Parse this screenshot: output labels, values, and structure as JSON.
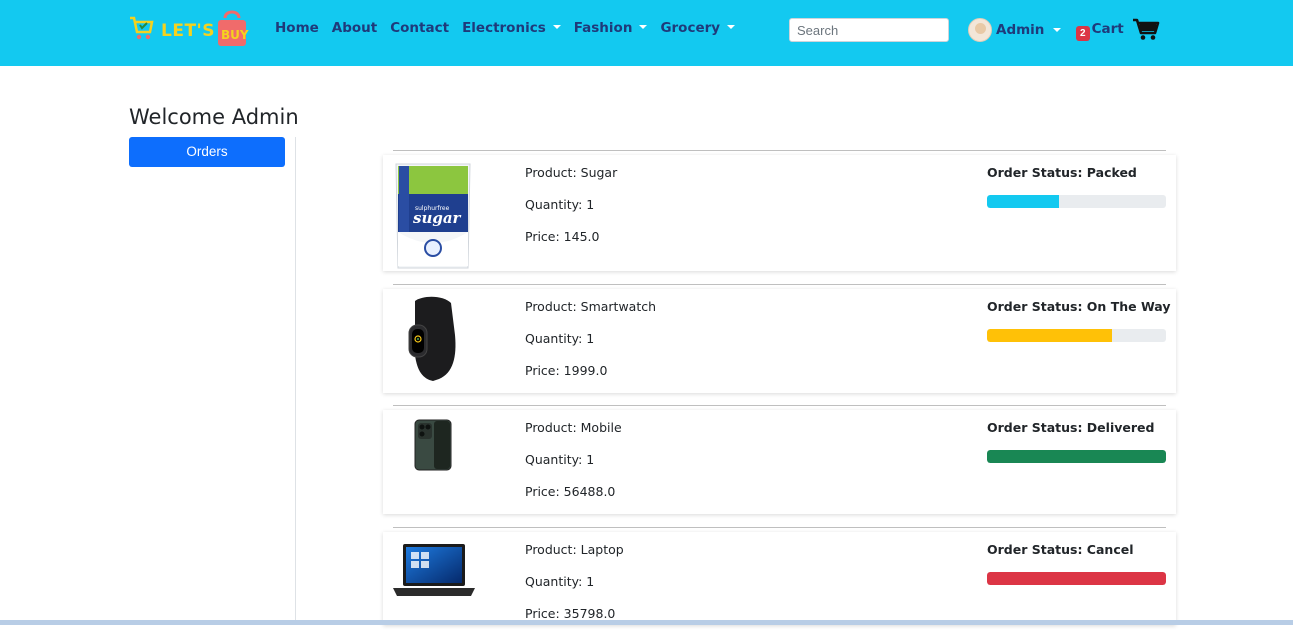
{
  "brand": {
    "text_lets": "LET'S",
    "text_buy": "BUY"
  },
  "nav": {
    "items": [
      {
        "label": "Home",
        "dropdown": false
      },
      {
        "label": "About",
        "dropdown": false
      },
      {
        "label": "Contact",
        "dropdown": false
      },
      {
        "label": "Electronics",
        "dropdown": true
      },
      {
        "label": "Fashion",
        "dropdown": true
      },
      {
        "label": "Grocery",
        "dropdown": true
      }
    ]
  },
  "search": {
    "placeholder": "Search",
    "value": ""
  },
  "user": {
    "name": "Admin"
  },
  "cart": {
    "count": "2",
    "label": "Cart"
  },
  "page": {
    "welcome": "Welcome Admin",
    "orders_button": "Orders"
  },
  "orders": [
    {
      "product": "Product: Sugar",
      "quantity": "Quantity: 1",
      "price": "Price: 145.0",
      "status": "Order Status: Packed",
      "progress": 0.4,
      "color": "#13c9f0",
      "image": "sugar-packet"
    },
    {
      "product": "Product: Smartwatch",
      "quantity": "Quantity: 1",
      "price": "Price: 1999.0",
      "status": "Order Status: On The Way",
      "progress": 0.7,
      "color": "#ffc107",
      "image": "smartwatch"
    },
    {
      "product": "Product: Mobile",
      "quantity": "Quantity: 1",
      "price": "Price: 56488.0",
      "status": "Order Status: Delivered",
      "progress": 1.0,
      "color": "#198754",
      "image": "mobile-phone"
    },
    {
      "product": "Product: Laptop",
      "quantity": "Quantity: 1",
      "price": "Price: 35798.0",
      "status": "Order Status: Cancel",
      "progress": 1.0,
      "color": "#dc3545",
      "image": "laptop"
    }
  ]
}
